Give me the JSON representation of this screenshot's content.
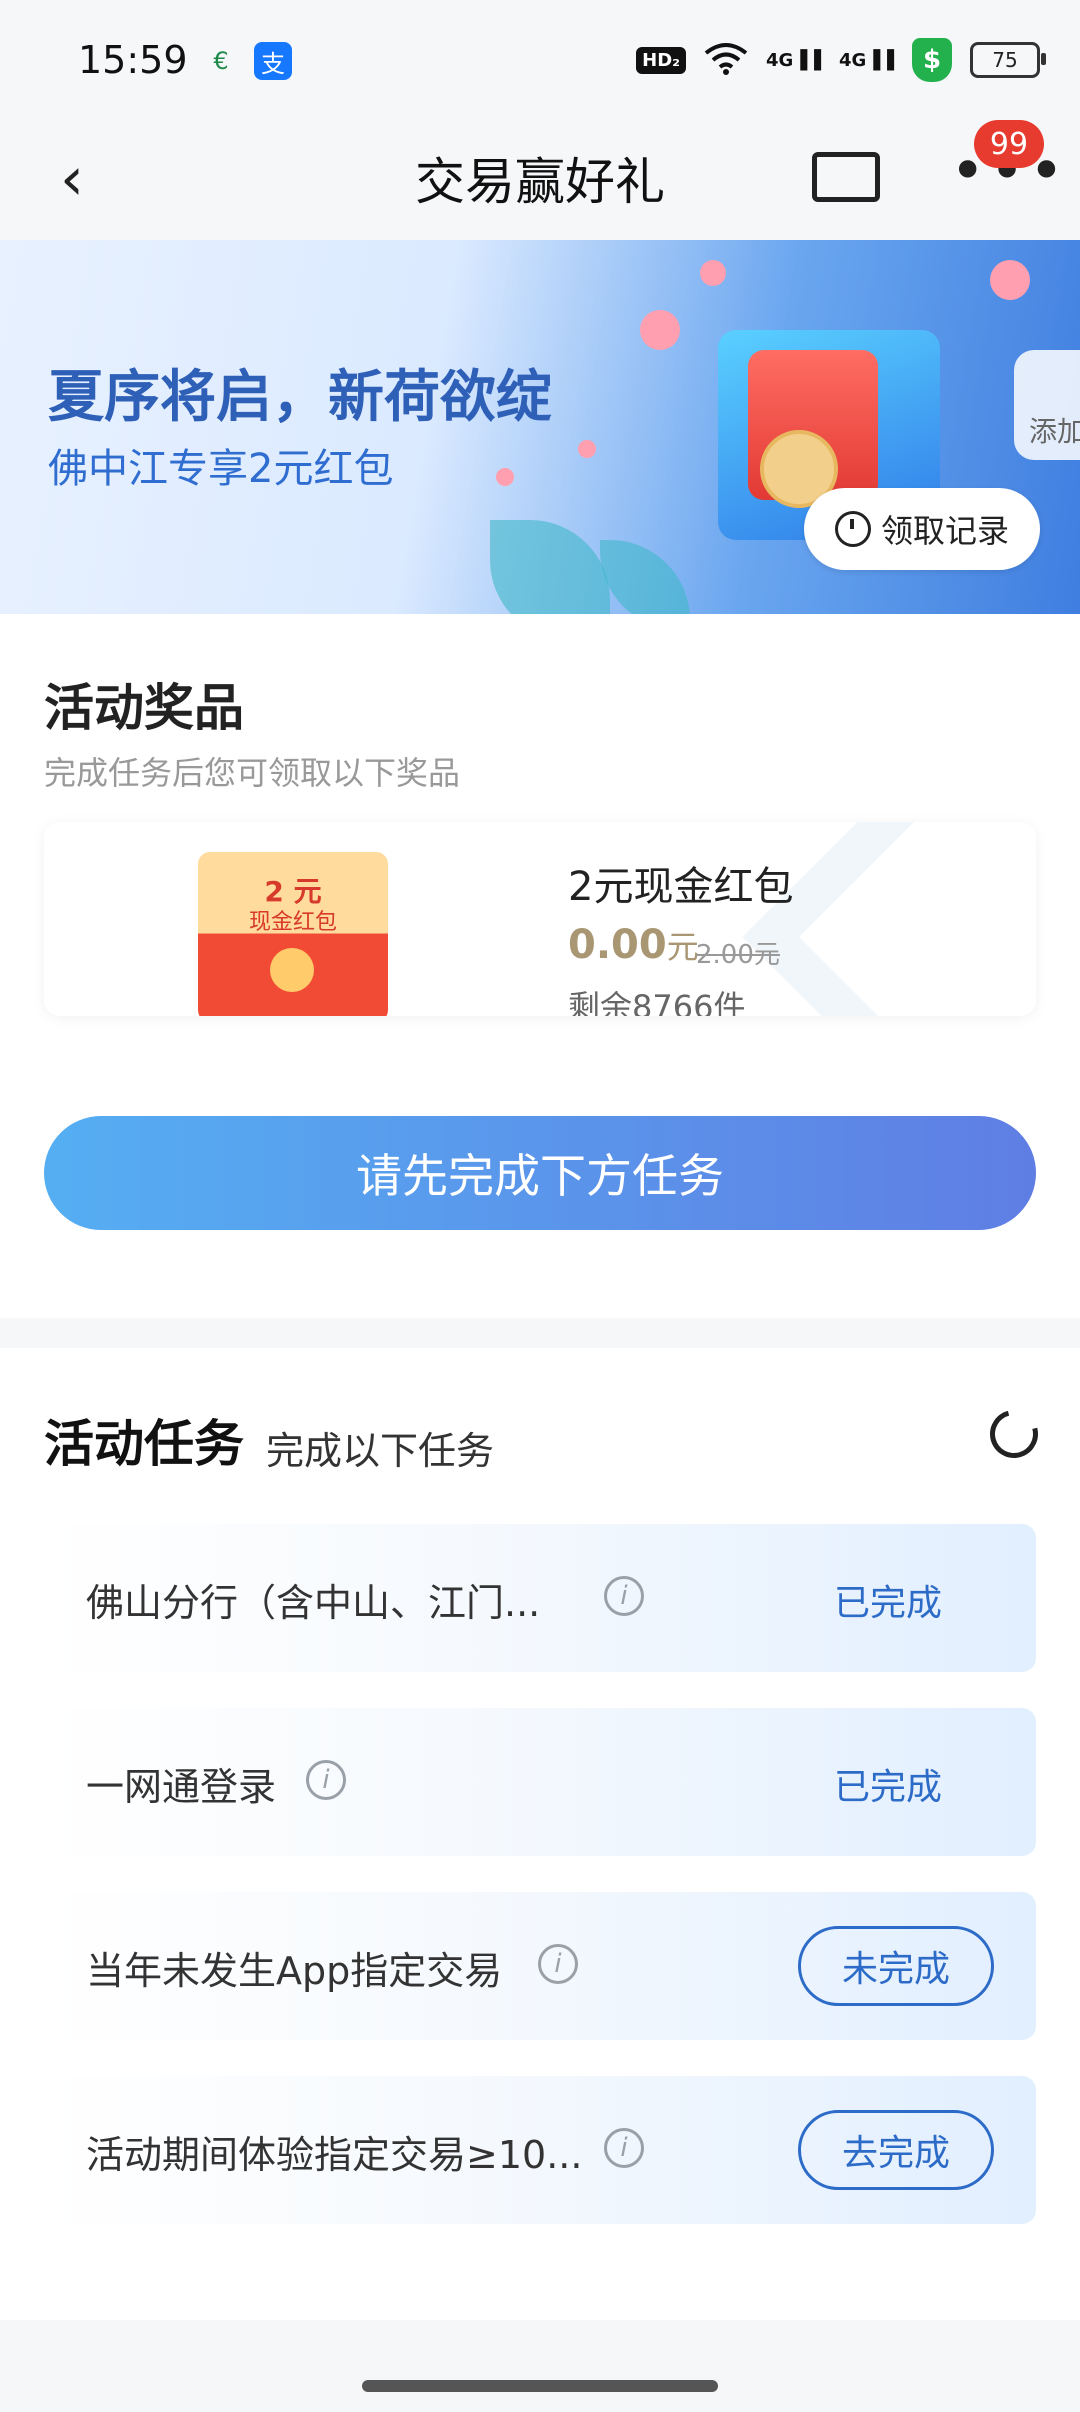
{
  "status_bar": {
    "time": "15:59",
    "app_icon_1": "€",
    "app_icon_2": "支",
    "hd": "HD₂",
    "signal_1": "4G▐▐",
    "signal_2": "4G▐▐",
    "shield": "$",
    "battery": "75"
  },
  "nav": {
    "back_symbol": "‹",
    "title": "交易赢好礼",
    "more_symbol": "•••",
    "badge": "99"
  },
  "banner": {
    "title": "夏序将启，新荷欲绽",
    "subtitle": "佛中江专享2元红包",
    "record_button": "领取记录",
    "add_side": "添加"
  },
  "prize": {
    "section_title": "活动奖品",
    "section_desc": "完成任务后您可领取以下奖品",
    "envelope_value": "2 元",
    "envelope_name": "现金红包",
    "name": "2元现金红包",
    "price": "0.00",
    "price_unit": "元",
    "original_price": "2.00元",
    "remaining": "剩余8766件",
    "cta": "请先完成下方任务"
  },
  "tasks": {
    "title": "活动任务",
    "subtitle": "完成以下任务",
    "info_symbol": "i",
    "items": [
      {
        "label": "佛山分行（含中山、江门...",
        "status": "已完成"
      },
      {
        "label": "一网通登录",
        "status": "已完成"
      },
      {
        "label": "当年未发生App指定交易",
        "status": "未完成"
      },
      {
        "label": "活动期间体验指定交易≥10...",
        "status": "去完成"
      }
    ]
  },
  "colors": {
    "accent_blue": "#2c6bc7",
    "cta_gradient_start": "#55aef2",
    "cta_gradient_end": "#5f7ee4",
    "badge_red": "#e63b2e",
    "price_gold": "#a99672"
  }
}
